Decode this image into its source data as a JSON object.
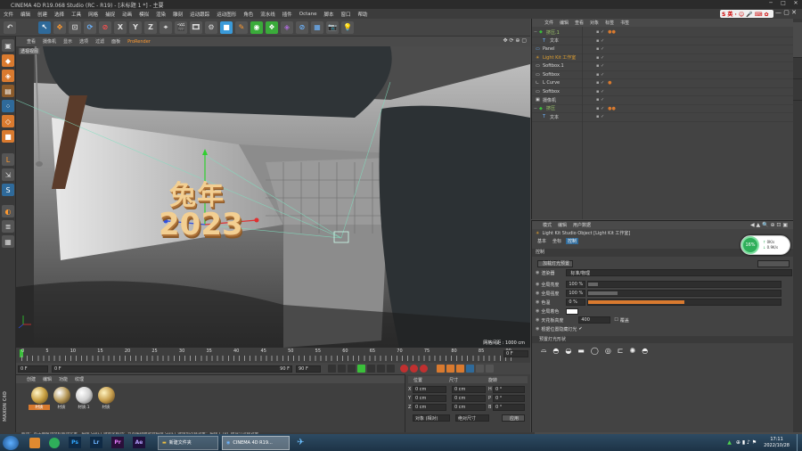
{
  "title": "CINEMA 4D R19.068 Studio (RC - R19) - [未标题 1 *] - 主要",
  "menu": [
    "文件",
    "编辑",
    "创建",
    "选择",
    "工具",
    "网格",
    "捕捉",
    "动画",
    "模拟",
    "渲染",
    "雕刻",
    "运动跟踪",
    "运动图形",
    "角色",
    "流水线",
    "插件",
    "Octane",
    "脚本",
    "窗口",
    "帮助"
  ],
  "viewport": {
    "menu": [
      "查看",
      "摄像机",
      "显示",
      "选项",
      "过滤",
      "面板"
    ],
    "renderer": "ProRender",
    "label": "透视视图",
    "scene_text_line1": "兔年",
    "scene_text_line2": "2023",
    "grid_info": "网格间距 : 1000 cm"
  },
  "timeline": {
    "ticks": [
      "0",
      "5",
      "10",
      "15",
      "20",
      "25",
      "30",
      "35",
      "40",
      "45",
      "50",
      "55",
      "60",
      "65",
      "70",
      "75",
      "80",
      "85",
      "90"
    ],
    "end_field": "0 F",
    "start_field": "0 F",
    "current_field": "0 F",
    "range_end": "90 F",
    "max_field": "90 F"
  },
  "material_panel": {
    "menu": [
      "创建",
      "编辑",
      "功能",
      "纹理"
    ],
    "materials": [
      "材质",
      "材质",
      "材质.1",
      "材质"
    ],
    "mat_colors": [
      "#c9a144",
      "#b89a5a",
      "#d0d0d0",
      "#c8a050"
    ]
  },
  "coord_panel": {
    "headers": [
      "位置",
      "尺寸",
      "旋转"
    ],
    "rows": [
      {
        "axis": "X",
        "pos": "0 cm",
        "size": "0 cm",
        "rot_axis": "H",
        "rot": "0 °"
      },
      {
        "axis": "Y",
        "pos": "0 cm",
        "size": "0 cm",
        "rot_axis": "P",
        "rot": "0 °"
      },
      {
        "axis": "Z",
        "pos": "0 cm",
        "size": "0 cm",
        "rot_axis": "B",
        "rot": "0 °"
      }
    ],
    "mode": "对象 (相对)",
    "size_mode": "绝对尺寸",
    "apply": "应用"
  },
  "object_panel": {
    "menu": [
      "文件",
      "编辑",
      "查看",
      "对象",
      "标签",
      "书签"
    ],
    "objects": [
      {
        "name": "挤压.1",
        "indent": 0,
        "color": "#9ecb6a"
      },
      {
        "name": "文本",
        "indent": 1,
        "color": "#d8d8d8"
      },
      {
        "name": "Panel",
        "indent": 0,
        "color": "#d8d8d8"
      },
      {
        "name": "Light Kit 工作室",
        "indent": 0,
        "color": "#e0a030"
      },
      {
        "name": "Softbox.1",
        "indent": 0,
        "color": "#d8d8d8"
      },
      {
        "name": "Softbox",
        "indent": 0,
        "color": "#d8d8d8"
      },
      {
        "name": "L Curve",
        "indent": 0,
        "color": "#d8d8d8"
      },
      {
        "name": "Softbox",
        "indent": 0,
        "color": "#d8d8d8"
      },
      {
        "name": "摄像机",
        "indent": 0,
        "color": "#d8d8d8"
      },
      {
        "name": "挤压",
        "indent": 0,
        "color": "#9ecb6a"
      },
      {
        "name": "文本",
        "indent": 1,
        "color": "#d8d8d8"
      }
    ]
  },
  "attr_panel": {
    "menu": [
      "模式",
      "编辑",
      "用户数据"
    ],
    "object_title": "Light Kit Studio Object [Light Kit 工作室]",
    "tabs": [
      "基本",
      "坐标",
      "控制"
    ],
    "section": "控制",
    "button_label": "加载灯光预置",
    "renderer_label": "渲染器",
    "renderer_value": "标准/物理",
    "global_brightness_label": "全局亮度",
    "global_brightness": "100 %",
    "global_brightness_pct": 0.05,
    "global_intensity_label": "全局强度",
    "global_intensity": "100 %",
    "global_intensity_pct": 0.15,
    "saturation_label": "色温",
    "saturation": "0 %",
    "saturation_pct": 0.5,
    "global_color_label": "全局着色",
    "ceiling_label": "天花板高度",
    "ceiling": "400",
    "cover_label": "覆盖",
    "hide_label": "根据位置隐藏灯光",
    "preset_section": "预置灯光形状",
    "badge_percent": "16%",
    "badge_up": "0K/s",
    "badge_down": "0.9K/s"
  },
  "status": "移动：点击并拖动鼠标移动元素。按住 SHIFT 键量化移动；节点编辑模式时按住 SHIFT 键增加选择对象；按住 CTRL 键减少选择对象。",
  "taskbar": {
    "folder_label": "新建文件夹",
    "c4d_label": "CINEMA 4D R19...",
    "time": "17:11",
    "date": "2022/10/28",
    "apps": [
      "Ps",
      "Lr",
      "Pr",
      "Ae"
    ]
  }
}
